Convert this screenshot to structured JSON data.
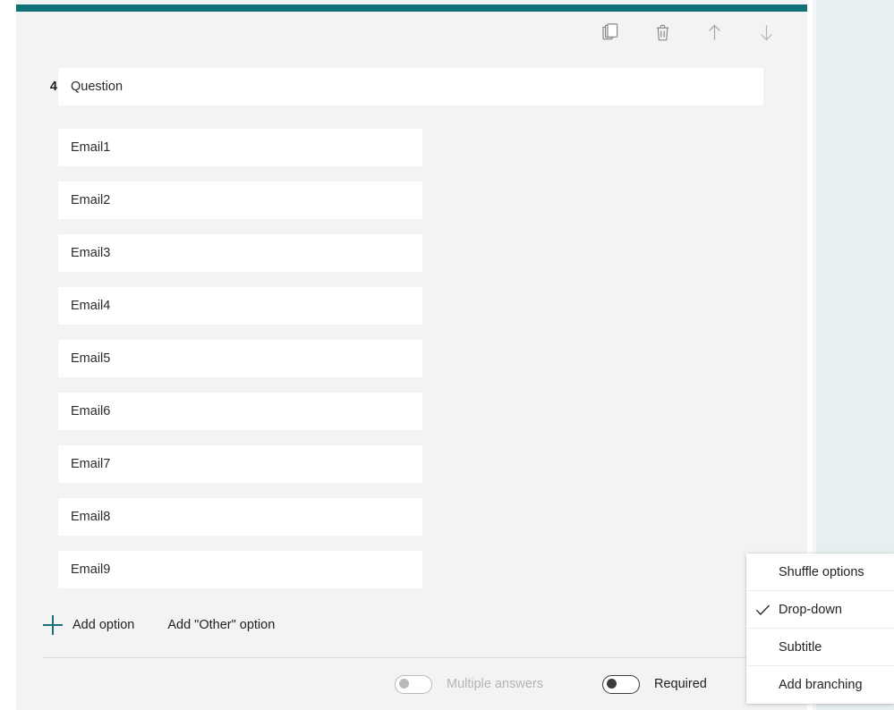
{
  "theme": {
    "accent": "#10717a",
    "card_bg": "#f3f3f3",
    "field_bg": "#ffffff",
    "side_panel_bg": "#e8eff0"
  },
  "toolbar": {
    "items": [
      {
        "name": "copy-icon",
        "tooltip": "Copy question"
      },
      {
        "name": "delete-icon",
        "tooltip": "Delete question"
      },
      {
        "name": "move-up-icon",
        "tooltip": "Move question up"
      },
      {
        "name": "move-down-icon",
        "tooltip": "Move question down"
      }
    ]
  },
  "question": {
    "number": "4.",
    "title_value": "Question",
    "title_placeholder": "Question"
  },
  "options": [
    {
      "value": "Email1"
    },
    {
      "value": "Email2"
    },
    {
      "value": "Email3"
    },
    {
      "value": "Email4"
    },
    {
      "value": "Email5"
    },
    {
      "value": "Email6"
    },
    {
      "value": "Email7"
    },
    {
      "value": "Email8"
    },
    {
      "value": "Email9"
    }
  ],
  "actions": {
    "add_option": "Add option",
    "add_other_option": "Add \"Other\" option"
  },
  "footer": {
    "multiple_answers": {
      "label": "Multiple answers",
      "state": "off",
      "disabled": true
    },
    "required": {
      "label": "Required",
      "state": "off",
      "disabled": false
    }
  },
  "context_menu": {
    "items": [
      {
        "label": "Shuffle options",
        "checked": false
      },
      {
        "label": "Drop-down",
        "checked": true
      },
      {
        "label": "Subtitle",
        "checked": false
      },
      {
        "label": "Add branching",
        "checked": false
      }
    ]
  }
}
